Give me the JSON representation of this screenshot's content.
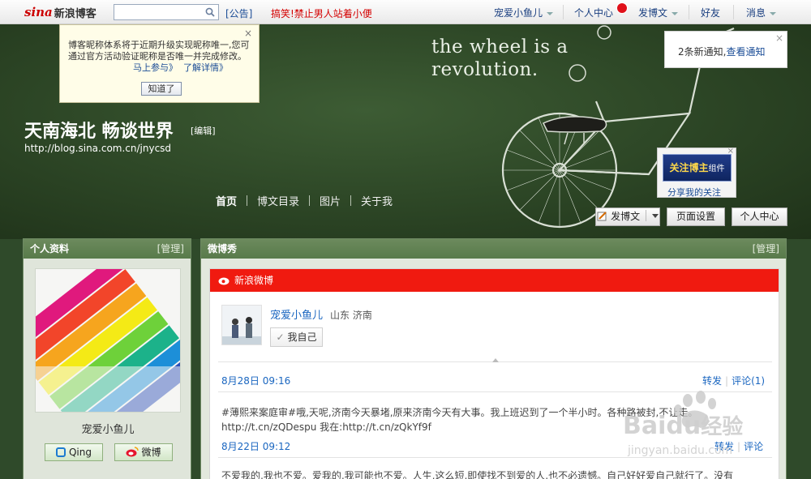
{
  "topbar": {
    "logo_sina": "sina",
    "logo_blog": "新浪博客",
    "search_placeholder": "",
    "notice": "[公告]",
    "joke": "搞笑!禁止男人站着小便",
    "user": "宠爱小鱼儿",
    "personal_center": "个人中心",
    "badge_count": "",
    "post_blog": "发博文",
    "friends": "好友",
    "messages": "消息"
  },
  "tip": {
    "text": "博客昵称体系将于近期升级实现昵称唯一,您可通过官方活动验证昵称是否唯一并完成修改。",
    "join": "马上参与》",
    "details": "了解详情》",
    "close": "×",
    "ok": "知道了"
  },
  "notify": {
    "text": "2条新通知,",
    "link": "查看通知",
    "close": "×"
  },
  "banner": {
    "slogan_line1": "the wheel is a",
    "slogan_line2": "revolution.",
    "title": "天南海北 畅谈世界",
    "edit": "[编辑]",
    "url": "http://blog.sina.com.cn/jnycsd",
    "tabs": [
      "首页",
      "博文目录",
      "图片",
      "关于我"
    ]
  },
  "follow_widget": {
    "title": "关注博主",
    "suffix": "组件",
    "share": "分享我的关注",
    "close": "×"
  },
  "banner_buttons": {
    "post": "发博文",
    "settings": "页面设置",
    "center": "个人中心"
  },
  "left_panel": {
    "title": "个人资料",
    "manage": "[管理]",
    "name": "宠爱小鱼儿",
    "qing": "Qing",
    "weibo": "微博"
  },
  "right_panel": {
    "title": "微博秀",
    "manage": "[管理]",
    "widget_title": "新浪微博",
    "user_name": "宠爱小鱼儿",
    "location": "山东 济南",
    "self_button": "我自己",
    "rows": [
      {
        "date": "8月28日 09:16",
        "forward": "转发",
        "comment": "评论(1)"
      },
      {
        "date": "8月22日 09:12",
        "forward": "转发",
        "comment": "评论"
      }
    ],
    "post_text": "#薄熙来案庭审#哦,天呢,济南今天暴堵,原来济南今天有大事。我上班迟到了一个半小时。各种路被封,不让走。http://t.cn/zQDespu 我在:http://t.cn/zQkYf9f",
    "post_text2": "不爱我的,我也不爱。爱我的,我可能也不爱。人生,这么短,即使找不到爱的人,也不必遗憾。自己好好爱自己就行了。没有"
  },
  "watermark": {
    "brand": "Baidu",
    "brand_cn": "经验",
    "url": "jingyan.baidu.com"
  },
  "colors": {
    "accent_red": "#f01a10",
    "link_blue": "#1a66c0",
    "panel_green": "#6c8a5d"
  }
}
